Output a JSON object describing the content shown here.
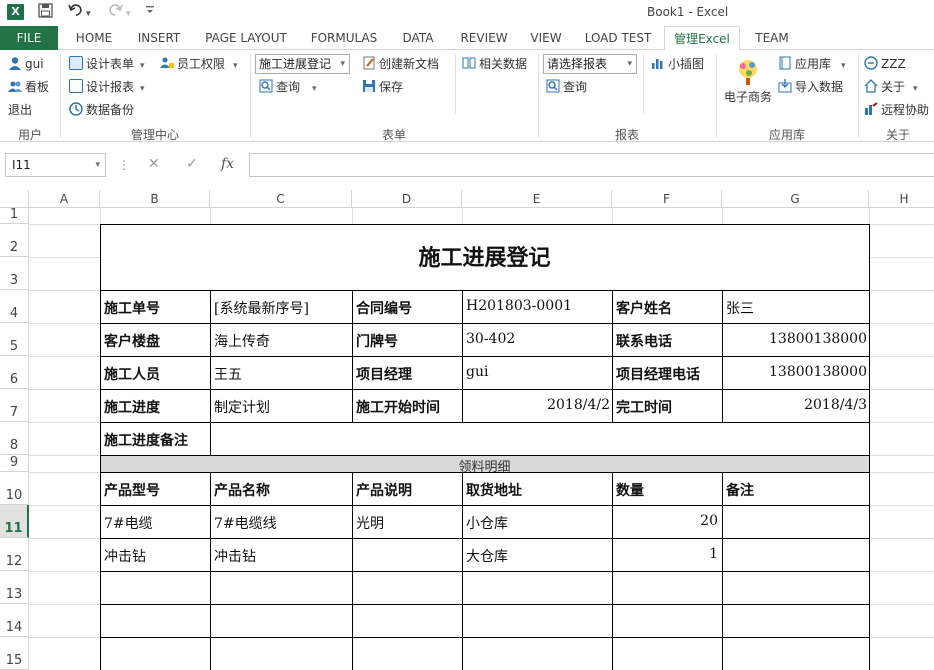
{
  "titlebar": {
    "title": "Book1 - Excel",
    "app_icon": "X",
    "redo_dropdown": "▾",
    "undo_dropdown": "▾"
  },
  "tabs": [
    "FILE",
    "HOME",
    "INSERT",
    "PAGE LAYOUT",
    "FORMULAS",
    "DATA",
    "REVIEW",
    "VIEW",
    "LOAD TEST",
    "管理Excel",
    "TEAM"
  ],
  "ribbon": {
    "user": {
      "name": "gui",
      "board": "看板",
      "logout": "退出",
      "group": "用户"
    },
    "mgmt": {
      "design_form": "设计表单",
      "design_report": "设计报表",
      "backup": "数据备份",
      "staff_perm": "员工权限",
      "group": "管理中心"
    },
    "form": {
      "combo": "施工进展登记",
      "query": "查询",
      "new_doc": "创建新文档",
      "save": "保存",
      "related": "相关数据",
      "group": "表单"
    },
    "report": {
      "combo": "请选择报表",
      "query": "查询",
      "chart": "小插图",
      "group": "报表"
    },
    "apps": {
      "ecom": "电子商务",
      "app_lib": "应用库",
      "import": "导入数据",
      "group": "应用库"
    },
    "about": {
      "zzz": "ZZZ",
      "about": "关于",
      "remote": "远程协助",
      "group": "关于"
    }
  },
  "formula_bar": {
    "cell_ref": "I11",
    "cancel": "✕",
    "enter": "✓",
    "fx": "fx",
    "value": ""
  },
  "columns": [
    "A",
    "B",
    "C",
    "D",
    "E",
    "F",
    "G",
    "H"
  ],
  "rows": [
    "1",
    "2",
    "3",
    "4",
    "5",
    "6",
    "7",
    "8",
    "9",
    "10",
    "11",
    "12",
    "13",
    "14",
    "15"
  ],
  "sheet": {
    "title": "施工进展登记",
    "r4": [
      "施工单号",
      "[系统最新序号]",
      "合同编号",
      "H201803-0001",
      "客户姓名",
      "张三"
    ],
    "r5": [
      "客户楼盘",
      "海上传奇",
      "门牌号",
      "30-402",
      "联系电话",
      "13800138000"
    ],
    "r6": [
      "施工人员",
      "王五",
      "项目经理",
      "gui",
      "项目经理电话",
      "13800138000"
    ],
    "r7": [
      "施工进度",
      "制定计划",
      "施工开始时间",
      "2018/4/2",
      "完工时间",
      "2018/4/3"
    ],
    "r8": [
      "施工进度备注"
    ],
    "section": "领料明细",
    "headers": [
      "产品型号",
      "产品名称",
      "产品说明",
      "取货地址",
      "数量",
      "备注"
    ],
    "items": [
      [
        "7#电缆",
        "7#电缆线",
        "光明",
        "小仓库",
        "20",
        ""
      ],
      [
        "冲击钻",
        "冲击钻",
        "",
        "大仓库",
        "1",
        ""
      ]
    ]
  }
}
